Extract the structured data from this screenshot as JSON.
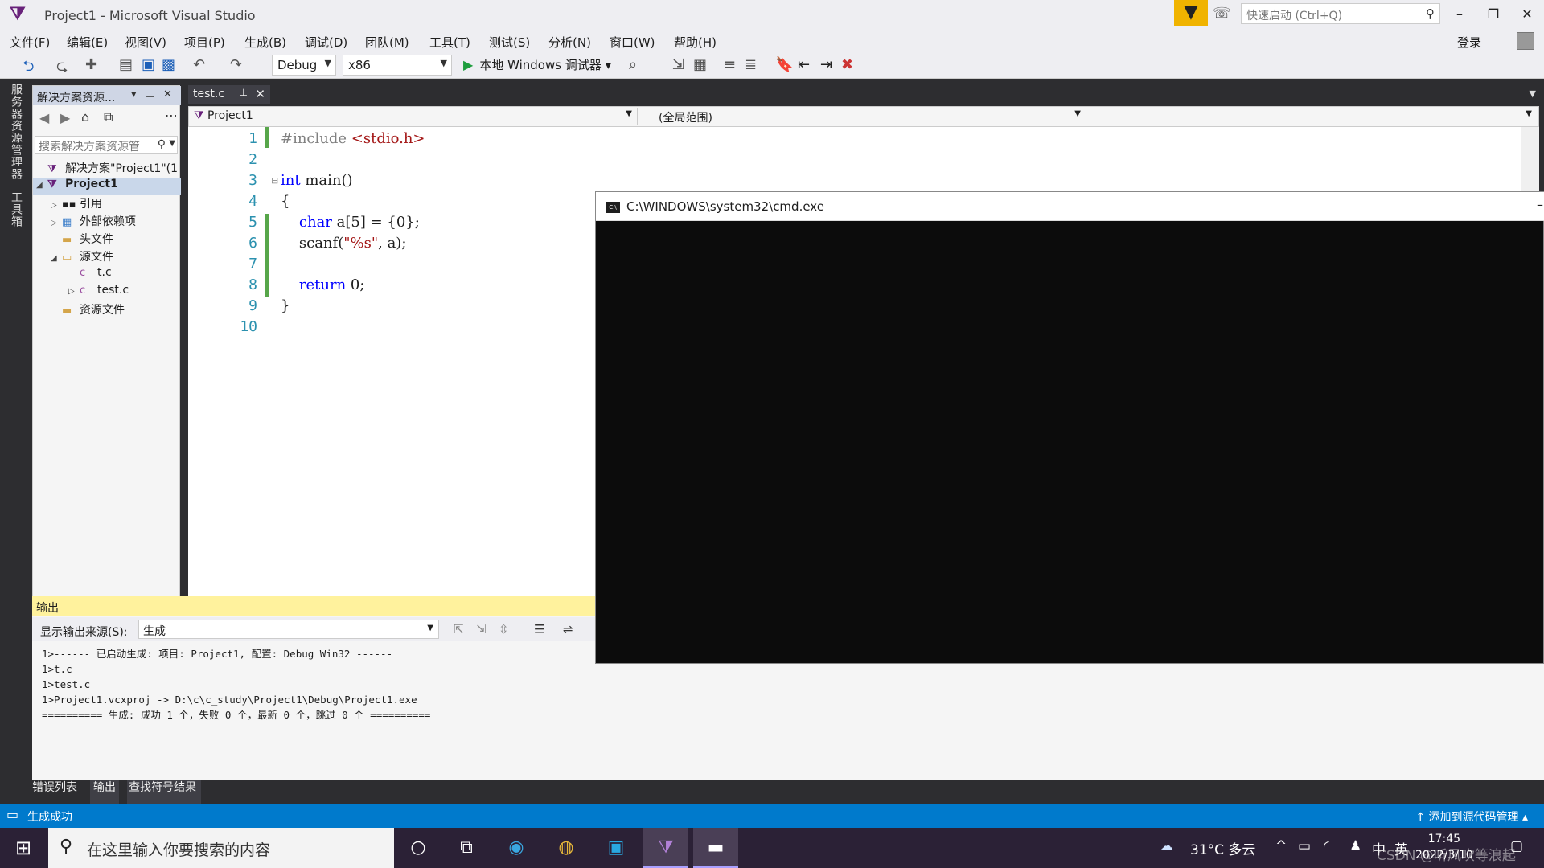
{
  "window": {
    "title": "Project1 - Microsoft Visual Studio",
    "quick_launch_placeholder": "快速启动 (Ctrl+Q)",
    "login": "登录"
  },
  "menu": [
    "文件(F)",
    "编辑(E)",
    "视图(V)",
    "项目(P)",
    "生成(B)",
    "调试(D)",
    "团队(M)",
    "工具(T)",
    "测试(S)",
    "分析(N)",
    "窗口(W)",
    "帮助(H)"
  ],
  "toolbar": {
    "config": "Debug",
    "platform": "x86",
    "run_label": "本地 Windows 调试器"
  },
  "side_tabs": [
    "服务器资源管理器",
    "工具箱"
  ],
  "solution_explorer": {
    "title": "解决方案资源...",
    "search_placeholder": "搜索解决方案资源管",
    "nodes": [
      "解决方案\"Project1\"(1",
      "Project1",
      "引用",
      "外部依赖项",
      "头文件",
      "源文件",
      "t.c",
      "test.c",
      "资源文件"
    ]
  },
  "editor": {
    "tab": "test.c",
    "nav_project": "Project1",
    "nav_scope": "(全局范围)",
    "line_numbers": [
      "1",
      "2",
      "3",
      "4",
      "5",
      "6",
      "7",
      "8",
      "9",
      "10"
    ]
  },
  "cmd": {
    "title": "C:\\WINDOWS\\system32\\cmd.exe"
  },
  "output": {
    "title": "输出",
    "source_label": "显示输出来源(S):",
    "source_value": "生成",
    "lines": [
      "1>------ 已启动生成: 项目: Project1, 配置: Debug Win32 ------",
      "1>t.c",
      "1>test.c",
      "1>Project1.vcxproj -> D:\\c\\c_study\\Project1\\Debug\\Project1.exe",
      "========== 生成: 成功 1 个，失败 0 个，最新 0 个，跳过 0 个 =========="
    ]
  },
  "bottom_tabs": [
    "错误列表",
    "输出",
    "查找符号结果"
  ],
  "status": {
    "message": "生成成功",
    "source_control": "添加到源代码管理"
  },
  "taskbar": {
    "search_placeholder": "在这里输入你要搜索的内容",
    "weather": "31°C 多云",
    "ime": "中",
    "ime2": "英",
    "time": "17:45",
    "date": "2022/3/10",
    "watermark": "CSDN @听风吹等浪起"
  }
}
